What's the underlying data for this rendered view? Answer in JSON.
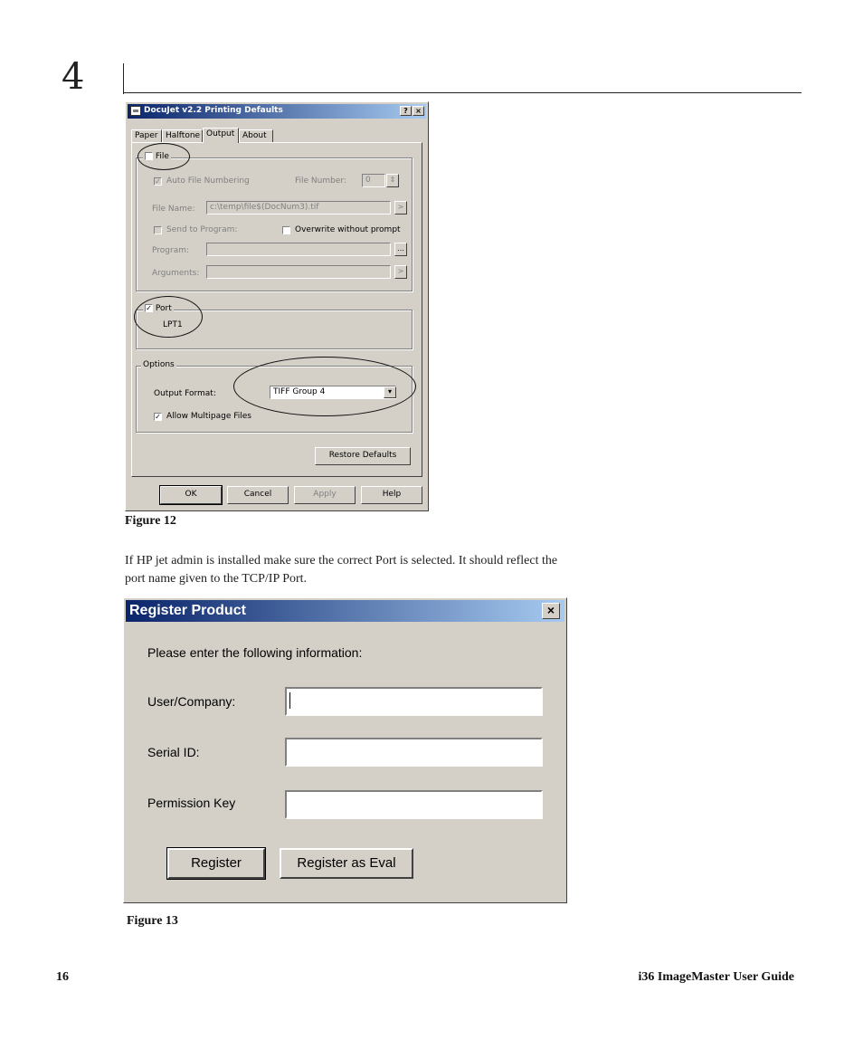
{
  "page": {
    "chapter_number": "4",
    "figure12_caption": "Figure 12",
    "body_line1": "If HP jet admin is installed make sure the correct Port is selected. It should reflect the",
    "body_line2": "port name given to the TCP/IP Port.",
    "figure13_caption": "Figure 13",
    "page_number": "16",
    "guide_title": "i36 ImageMaster User Guide"
  },
  "docujet": {
    "title": "DocuJet v2.2 Printing Defaults",
    "help_btn": "?",
    "close_btn": "×",
    "tabs": [
      "Paper",
      "Halftone",
      "Output",
      "About"
    ],
    "file_label": "File",
    "auto_numbering_label": "Auto File Numbering",
    "file_number_label": "File Number:",
    "file_number_value": "0",
    "file_name_label": "File Name:",
    "file_name_value": "c:\\temp\\file$(DocNum3).tif",
    "send_to_program_label": "Send to Program:",
    "overwrite_label": "Overwrite without prompt",
    "program_label": "Program:",
    "arguments_label": "Arguments:",
    "port_label": "Port",
    "port_value": "LPT1",
    "options_label": "Options",
    "output_format_label": "Output Format:",
    "output_format_value": "TIFF Group 4",
    "multipage_label": "Allow Multipage Files",
    "restore_defaults": "Restore Defaults",
    "ok": "OK",
    "cancel": "Cancel",
    "apply": "Apply",
    "help": "Help"
  },
  "register": {
    "title": "Register Product",
    "close_btn": "×",
    "instruction": "Please enter the following information:",
    "user_company_label": "User/Company:",
    "serial_id_label": "Serial ID:",
    "permission_key_label": "Permission Key",
    "register_btn": "Register",
    "register_eval_btn": "Register as Eval"
  },
  "colors": {
    "titlebar_start": "#0a246a",
    "titlebar_end": "#a6caf0",
    "dialog_face": "#d4d0c8"
  }
}
